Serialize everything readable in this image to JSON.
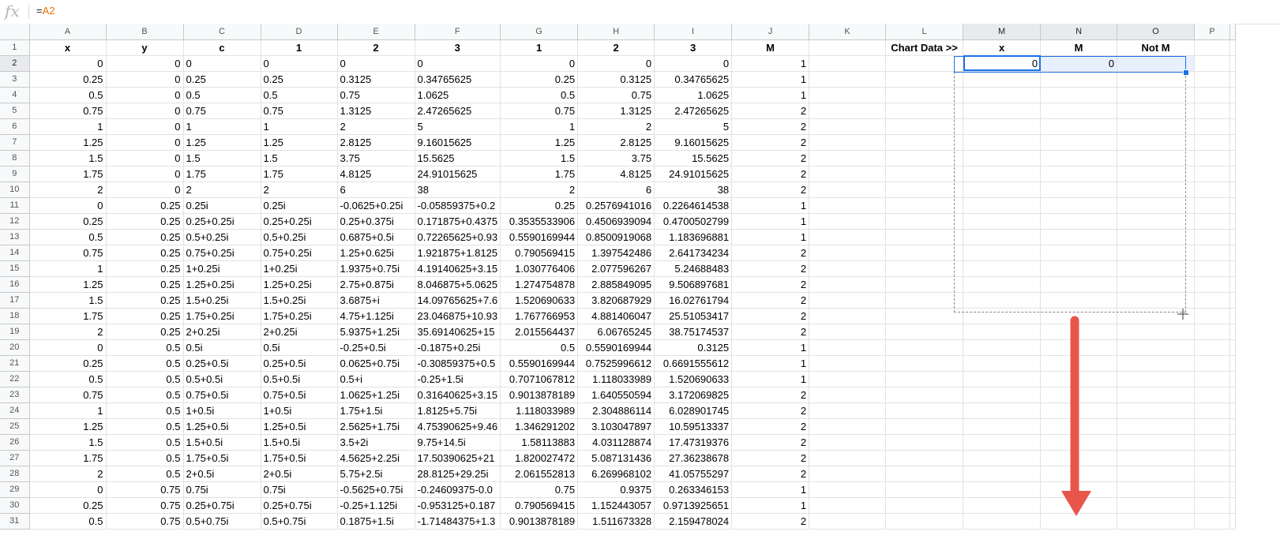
{
  "formula_bar": {
    "icon": "fx-icon",
    "prefix": "=",
    "ref": "A2"
  },
  "columns": [
    "A",
    "B",
    "C",
    "D",
    "E",
    "F",
    "G",
    "H",
    "I",
    "J",
    "K",
    "L",
    "M",
    "N",
    "O",
    "P"
  ],
  "selected_columns": [
    "M",
    "N",
    "O"
  ],
  "rows": [
    [
      {
        "v": "x",
        "c": "hdr"
      },
      {
        "v": "y",
        "c": "hdr"
      },
      {
        "v": "c",
        "c": "hdr"
      },
      {
        "v": "1",
        "c": "hdr"
      },
      {
        "v": "2",
        "c": "hdr"
      },
      {
        "v": "3",
        "c": "hdr"
      },
      {
        "v": "1",
        "c": "hdr"
      },
      {
        "v": "2",
        "c": "hdr"
      },
      {
        "v": "3",
        "c": "hdr"
      },
      {
        "v": "M",
        "c": "hdr"
      },
      {
        "v": "",
        "c": "txt"
      },
      {
        "v": "Chart Data >>",
        "c": "hdr"
      },
      {
        "v": "x",
        "c": "hdr"
      },
      {
        "v": "M",
        "c": "hdr"
      },
      {
        "v": "Not M",
        "c": "hdr"
      },
      {
        "v": "",
        "c": "txt"
      }
    ],
    [
      {
        "v": "0",
        "c": "num"
      },
      {
        "v": "0",
        "c": "num"
      },
      {
        "v": "0",
        "c": "txt"
      },
      {
        "v": "0",
        "c": "txt"
      },
      {
        "v": "0",
        "c": "txt"
      },
      {
        "v": "0",
        "c": "txt"
      },
      {
        "v": "0",
        "c": "num"
      },
      {
        "v": "0",
        "c": "num"
      },
      {
        "v": "0",
        "c": "num"
      },
      {
        "v": "1",
        "c": "num"
      },
      {
        "v": "",
        "c": "txt"
      },
      {
        "v": "",
        "c": "txt"
      },
      {
        "v": "0",
        "c": "num active"
      },
      {
        "v": "0",
        "c": "num selcell"
      },
      {
        "v": "",
        "c": "txt selcell"
      },
      {
        "v": "",
        "c": "txt"
      }
    ],
    [
      {
        "v": "0.25",
        "c": "num"
      },
      {
        "v": "0",
        "c": "num"
      },
      {
        "v": "0.25",
        "c": "txt"
      },
      {
        "v": "0.25",
        "c": "txt"
      },
      {
        "v": "0.3125",
        "c": "txt"
      },
      {
        "v": "0.34765625",
        "c": "txt"
      },
      {
        "v": "0.25",
        "c": "num"
      },
      {
        "v": "0.3125",
        "c": "num"
      },
      {
        "v": "0.34765625",
        "c": "num"
      },
      {
        "v": "1",
        "c": "num"
      }
    ],
    [
      {
        "v": "0.5",
        "c": "num"
      },
      {
        "v": "0",
        "c": "num"
      },
      {
        "v": "0.5",
        "c": "txt"
      },
      {
        "v": "0.5",
        "c": "txt"
      },
      {
        "v": "0.75",
        "c": "txt"
      },
      {
        "v": "1.0625",
        "c": "txt"
      },
      {
        "v": "0.5",
        "c": "num"
      },
      {
        "v": "0.75",
        "c": "num"
      },
      {
        "v": "1.0625",
        "c": "num"
      },
      {
        "v": "1",
        "c": "num"
      }
    ],
    [
      {
        "v": "0.75",
        "c": "num"
      },
      {
        "v": "0",
        "c": "num"
      },
      {
        "v": "0.75",
        "c": "txt"
      },
      {
        "v": "0.75",
        "c": "txt"
      },
      {
        "v": "1.3125",
        "c": "txt"
      },
      {
        "v": "2.47265625",
        "c": "txt"
      },
      {
        "v": "0.75",
        "c": "num"
      },
      {
        "v": "1.3125",
        "c": "num"
      },
      {
        "v": "2.47265625",
        "c": "num"
      },
      {
        "v": "2",
        "c": "num"
      }
    ],
    [
      {
        "v": "1",
        "c": "num"
      },
      {
        "v": "0",
        "c": "num"
      },
      {
        "v": "1",
        "c": "txt"
      },
      {
        "v": "1",
        "c": "txt"
      },
      {
        "v": "2",
        "c": "txt"
      },
      {
        "v": "5",
        "c": "txt"
      },
      {
        "v": "1",
        "c": "num"
      },
      {
        "v": "2",
        "c": "num"
      },
      {
        "v": "5",
        "c": "num"
      },
      {
        "v": "2",
        "c": "num"
      }
    ],
    [
      {
        "v": "1.25",
        "c": "num"
      },
      {
        "v": "0",
        "c": "num"
      },
      {
        "v": "1.25",
        "c": "txt"
      },
      {
        "v": "1.25",
        "c": "txt"
      },
      {
        "v": "2.8125",
        "c": "txt"
      },
      {
        "v": "9.16015625",
        "c": "txt"
      },
      {
        "v": "1.25",
        "c": "num"
      },
      {
        "v": "2.8125",
        "c": "num"
      },
      {
        "v": "9.16015625",
        "c": "num"
      },
      {
        "v": "2",
        "c": "num"
      }
    ],
    [
      {
        "v": "1.5",
        "c": "num"
      },
      {
        "v": "0",
        "c": "num"
      },
      {
        "v": "1.5",
        "c": "txt"
      },
      {
        "v": "1.5",
        "c": "txt"
      },
      {
        "v": "3.75",
        "c": "txt"
      },
      {
        "v": "15.5625",
        "c": "txt"
      },
      {
        "v": "1.5",
        "c": "num"
      },
      {
        "v": "3.75",
        "c": "num"
      },
      {
        "v": "15.5625",
        "c": "num"
      },
      {
        "v": "2",
        "c": "num"
      }
    ],
    [
      {
        "v": "1.75",
        "c": "num"
      },
      {
        "v": "0",
        "c": "num"
      },
      {
        "v": "1.75",
        "c": "txt"
      },
      {
        "v": "1.75",
        "c": "txt"
      },
      {
        "v": "4.8125",
        "c": "txt"
      },
      {
        "v": "24.91015625",
        "c": "txt"
      },
      {
        "v": "1.75",
        "c": "num"
      },
      {
        "v": "4.8125",
        "c": "num"
      },
      {
        "v": "24.91015625",
        "c": "num"
      },
      {
        "v": "2",
        "c": "num"
      }
    ],
    [
      {
        "v": "2",
        "c": "num"
      },
      {
        "v": "0",
        "c": "num"
      },
      {
        "v": "2",
        "c": "txt"
      },
      {
        "v": "2",
        "c": "txt"
      },
      {
        "v": "6",
        "c": "txt"
      },
      {
        "v": "38",
        "c": "txt"
      },
      {
        "v": "2",
        "c": "num"
      },
      {
        "v": "6",
        "c": "num"
      },
      {
        "v": "38",
        "c": "num"
      },
      {
        "v": "2",
        "c": "num"
      }
    ],
    [
      {
        "v": "0",
        "c": "num"
      },
      {
        "v": "0.25",
        "c": "num"
      },
      {
        "v": "0.25i",
        "c": "txt"
      },
      {
        "v": "0.25i",
        "c": "txt"
      },
      {
        "v": "-0.0625+0.25i",
        "c": "txt"
      },
      {
        "v": "-0.05859375+0.2",
        "c": "txt"
      },
      {
        "v": "0.25",
        "c": "num"
      },
      {
        "v": "0.2576941016",
        "c": "num"
      },
      {
        "v": "0.2264614538",
        "c": "num"
      },
      {
        "v": "1",
        "c": "num"
      }
    ],
    [
      {
        "v": "0.25",
        "c": "num"
      },
      {
        "v": "0.25",
        "c": "num"
      },
      {
        "v": "0.25+0.25i",
        "c": "txt"
      },
      {
        "v": "0.25+0.25i",
        "c": "txt"
      },
      {
        "v": "0.25+0.375i",
        "c": "txt"
      },
      {
        "v": "0.171875+0.4375",
        "c": "txt"
      },
      {
        "v": "0.3535533906",
        "c": "num"
      },
      {
        "v": "0.4506939094",
        "c": "num"
      },
      {
        "v": "0.4700502799",
        "c": "num"
      },
      {
        "v": "1",
        "c": "num"
      }
    ],
    [
      {
        "v": "0.5",
        "c": "num"
      },
      {
        "v": "0.25",
        "c": "num"
      },
      {
        "v": "0.5+0.25i",
        "c": "txt"
      },
      {
        "v": "0.5+0.25i",
        "c": "txt"
      },
      {
        "v": "0.6875+0.5i",
        "c": "txt"
      },
      {
        "v": "0.72265625+0.93",
        "c": "txt"
      },
      {
        "v": "0.5590169944",
        "c": "num"
      },
      {
        "v": "0.8500919068",
        "c": "num"
      },
      {
        "v": "1.183696881",
        "c": "num"
      },
      {
        "v": "1",
        "c": "num"
      }
    ],
    [
      {
        "v": "0.75",
        "c": "num"
      },
      {
        "v": "0.25",
        "c": "num"
      },
      {
        "v": "0.75+0.25i",
        "c": "txt"
      },
      {
        "v": "0.75+0.25i",
        "c": "txt"
      },
      {
        "v": "1.25+0.625i",
        "c": "txt"
      },
      {
        "v": "1.921875+1.8125",
        "c": "txt"
      },
      {
        "v": "0.790569415",
        "c": "num"
      },
      {
        "v": "1.397542486",
        "c": "num"
      },
      {
        "v": "2.641734234",
        "c": "num"
      },
      {
        "v": "2",
        "c": "num"
      }
    ],
    [
      {
        "v": "1",
        "c": "num"
      },
      {
        "v": "0.25",
        "c": "num"
      },
      {
        "v": "1+0.25i",
        "c": "txt"
      },
      {
        "v": "1+0.25i",
        "c": "txt"
      },
      {
        "v": "1.9375+0.75i",
        "c": "txt"
      },
      {
        "v": "4.19140625+3.15",
        "c": "txt"
      },
      {
        "v": "1.030776406",
        "c": "num"
      },
      {
        "v": "2.077596267",
        "c": "num"
      },
      {
        "v": "5.24688483",
        "c": "num"
      },
      {
        "v": "2",
        "c": "num"
      }
    ],
    [
      {
        "v": "1.25",
        "c": "num"
      },
      {
        "v": "0.25",
        "c": "num"
      },
      {
        "v": "1.25+0.25i",
        "c": "txt"
      },
      {
        "v": "1.25+0.25i",
        "c": "txt"
      },
      {
        "v": "2.75+0.875i",
        "c": "txt"
      },
      {
        "v": "8.046875+5.0625",
        "c": "txt"
      },
      {
        "v": "1.274754878",
        "c": "num"
      },
      {
        "v": "2.885849095",
        "c": "num"
      },
      {
        "v": "9.506897681",
        "c": "num"
      },
      {
        "v": "2",
        "c": "num"
      }
    ],
    [
      {
        "v": "1.5",
        "c": "num"
      },
      {
        "v": "0.25",
        "c": "num"
      },
      {
        "v": "1.5+0.25i",
        "c": "txt"
      },
      {
        "v": "1.5+0.25i",
        "c": "txt"
      },
      {
        "v": "3.6875+i",
        "c": "txt"
      },
      {
        "v": "14.09765625+7.6",
        "c": "txt"
      },
      {
        "v": "1.520690633",
        "c": "num"
      },
      {
        "v": "3.820687929",
        "c": "num"
      },
      {
        "v": "16.02761794",
        "c": "num"
      },
      {
        "v": "2",
        "c": "num"
      }
    ],
    [
      {
        "v": "1.75",
        "c": "num"
      },
      {
        "v": "0.25",
        "c": "num"
      },
      {
        "v": "1.75+0.25i",
        "c": "txt"
      },
      {
        "v": "1.75+0.25i",
        "c": "txt"
      },
      {
        "v": "4.75+1.125i",
        "c": "txt"
      },
      {
        "v": "23.046875+10.93",
        "c": "txt"
      },
      {
        "v": "1.767766953",
        "c": "num"
      },
      {
        "v": "4.881406047",
        "c": "num"
      },
      {
        "v": "25.51053417",
        "c": "num"
      },
      {
        "v": "2",
        "c": "num"
      }
    ],
    [
      {
        "v": "2",
        "c": "num"
      },
      {
        "v": "0.25",
        "c": "num"
      },
      {
        "v": "2+0.25i",
        "c": "txt"
      },
      {
        "v": "2+0.25i",
        "c": "txt"
      },
      {
        "v": "5.9375+1.25i",
        "c": "txt"
      },
      {
        "v": "35.69140625+15",
        "c": "txt"
      },
      {
        "v": "2.015564437",
        "c": "num"
      },
      {
        "v": "6.06765245",
        "c": "num"
      },
      {
        "v": "38.75174537",
        "c": "num"
      },
      {
        "v": "2",
        "c": "num"
      }
    ],
    [
      {
        "v": "0",
        "c": "num"
      },
      {
        "v": "0.5",
        "c": "num"
      },
      {
        "v": "0.5i",
        "c": "txt"
      },
      {
        "v": "0.5i",
        "c": "txt"
      },
      {
        "v": "-0.25+0.5i",
        "c": "txt"
      },
      {
        "v": "-0.1875+0.25i",
        "c": "txt"
      },
      {
        "v": "0.5",
        "c": "num"
      },
      {
        "v": "0.5590169944",
        "c": "num"
      },
      {
        "v": "0.3125",
        "c": "num"
      },
      {
        "v": "1",
        "c": "num"
      }
    ],
    [
      {
        "v": "0.25",
        "c": "num"
      },
      {
        "v": "0.5",
        "c": "num"
      },
      {
        "v": "0.25+0.5i",
        "c": "txt"
      },
      {
        "v": "0.25+0.5i",
        "c": "txt"
      },
      {
        "v": "0.0625+0.75i",
        "c": "txt"
      },
      {
        "v": "-0.30859375+0.5",
        "c": "txt"
      },
      {
        "v": "0.5590169944",
        "c": "num"
      },
      {
        "v": "0.7525996612",
        "c": "num"
      },
      {
        "v": "0.6691555612",
        "c": "num"
      },
      {
        "v": "1",
        "c": "num"
      }
    ],
    [
      {
        "v": "0.5",
        "c": "num"
      },
      {
        "v": "0.5",
        "c": "num"
      },
      {
        "v": "0.5+0.5i",
        "c": "txt"
      },
      {
        "v": "0.5+0.5i",
        "c": "txt"
      },
      {
        "v": "0.5+i",
        "c": "txt"
      },
      {
        "v": "-0.25+1.5i",
        "c": "txt"
      },
      {
        "v": "0.7071067812",
        "c": "num"
      },
      {
        "v": "1.118033989",
        "c": "num"
      },
      {
        "v": "1.520690633",
        "c": "num"
      },
      {
        "v": "1",
        "c": "num"
      }
    ],
    [
      {
        "v": "0.75",
        "c": "num"
      },
      {
        "v": "0.5",
        "c": "num"
      },
      {
        "v": "0.75+0.5i",
        "c": "txt"
      },
      {
        "v": "0.75+0.5i",
        "c": "txt"
      },
      {
        "v": "1.0625+1.25i",
        "c": "txt"
      },
      {
        "v": "0.31640625+3.15",
        "c": "txt"
      },
      {
        "v": "0.9013878189",
        "c": "num"
      },
      {
        "v": "1.640550594",
        "c": "num"
      },
      {
        "v": "3.172069825",
        "c": "num"
      },
      {
        "v": "2",
        "c": "num"
      }
    ],
    [
      {
        "v": "1",
        "c": "num"
      },
      {
        "v": "0.5",
        "c": "num"
      },
      {
        "v": "1+0.5i",
        "c": "txt"
      },
      {
        "v": "1+0.5i",
        "c": "txt"
      },
      {
        "v": "1.75+1.5i",
        "c": "txt"
      },
      {
        "v": "1.8125+5.75i",
        "c": "txt"
      },
      {
        "v": "1.118033989",
        "c": "num"
      },
      {
        "v": "2.304886114",
        "c": "num"
      },
      {
        "v": "6.028901745",
        "c": "num"
      },
      {
        "v": "2",
        "c": "num"
      }
    ],
    [
      {
        "v": "1.25",
        "c": "num"
      },
      {
        "v": "0.5",
        "c": "num"
      },
      {
        "v": "1.25+0.5i",
        "c": "txt"
      },
      {
        "v": "1.25+0.5i",
        "c": "txt"
      },
      {
        "v": "2.5625+1.75i",
        "c": "txt"
      },
      {
        "v": "4.75390625+9.46",
        "c": "txt"
      },
      {
        "v": "1.346291202",
        "c": "num"
      },
      {
        "v": "3.103047897",
        "c": "num"
      },
      {
        "v": "10.59513337",
        "c": "num"
      },
      {
        "v": "2",
        "c": "num"
      }
    ],
    [
      {
        "v": "1.5",
        "c": "num"
      },
      {
        "v": "0.5",
        "c": "num"
      },
      {
        "v": "1.5+0.5i",
        "c": "txt"
      },
      {
        "v": "1.5+0.5i",
        "c": "txt"
      },
      {
        "v": "3.5+2i",
        "c": "txt"
      },
      {
        "v": "9.75+14.5i",
        "c": "txt"
      },
      {
        "v": "1.58113883",
        "c": "num"
      },
      {
        "v": "4.031128874",
        "c": "num"
      },
      {
        "v": "17.47319376",
        "c": "num"
      },
      {
        "v": "2",
        "c": "num"
      }
    ],
    [
      {
        "v": "1.75",
        "c": "num"
      },
      {
        "v": "0.5",
        "c": "num"
      },
      {
        "v": "1.75+0.5i",
        "c": "txt"
      },
      {
        "v": "1.75+0.5i",
        "c": "txt"
      },
      {
        "v": "4.5625+2.25i",
        "c": "txt"
      },
      {
        "v": "17.50390625+21",
        "c": "txt"
      },
      {
        "v": "1.820027472",
        "c": "num"
      },
      {
        "v": "5.087131436",
        "c": "num"
      },
      {
        "v": "27.36238678",
        "c": "num"
      },
      {
        "v": "2",
        "c": "num"
      }
    ],
    [
      {
        "v": "2",
        "c": "num"
      },
      {
        "v": "0.5",
        "c": "num"
      },
      {
        "v": "2+0.5i",
        "c": "txt"
      },
      {
        "v": "2+0.5i",
        "c": "txt"
      },
      {
        "v": "5.75+2.5i",
        "c": "txt"
      },
      {
        "v": "28.8125+29.25i",
        "c": "txt"
      },
      {
        "v": "2.061552813",
        "c": "num"
      },
      {
        "v": "6.269968102",
        "c": "num"
      },
      {
        "v": "41.05755297",
        "c": "num"
      },
      {
        "v": "2",
        "c": "num"
      }
    ],
    [
      {
        "v": "0",
        "c": "num"
      },
      {
        "v": "0.75",
        "c": "num"
      },
      {
        "v": "0.75i",
        "c": "txt"
      },
      {
        "v": "0.75i",
        "c": "txt"
      },
      {
        "v": "-0.5625+0.75i",
        "c": "txt"
      },
      {
        "v": "-0.24609375-0.0",
        "c": "txt"
      },
      {
        "v": "0.75",
        "c": "num"
      },
      {
        "v": "0.9375",
        "c": "num"
      },
      {
        "v": "0.263346153",
        "c": "num"
      },
      {
        "v": "1",
        "c": "num"
      }
    ],
    [
      {
        "v": "0.25",
        "c": "num"
      },
      {
        "v": "0.75",
        "c": "num"
      },
      {
        "v": "0.25+0.75i",
        "c": "txt"
      },
      {
        "v": "0.25+0.75i",
        "c": "txt"
      },
      {
        "v": "-0.25+1.125i",
        "c": "txt"
      },
      {
        "v": "-0.953125+0.187",
        "c": "txt"
      },
      {
        "v": "0.790569415",
        "c": "num"
      },
      {
        "v": "1.152443057",
        "c": "num"
      },
      {
        "v": "0.9713925651",
        "c": "num"
      },
      {
        "v": "1",
        "c": "num"
      }
    ],
    [
      {
        "v": "0.5",
        "c": "num"
      },
      {
        "v": "0.75",
        "c": "num"
      },
      {
        "v": "0.5+0.75i",
        "c": "txt"
      },
      {
        "v": "0.5+0.75i",
        "c": "txt"
      },
      {
        "v": "0.1875+1.5i",
        "c": "txt"
      },
      {
        "v": "-1.71484375+1.3",
        "c": "txt"
      },
      {
        "v": "0.9013878189",
        "c": "num"
      },
      {
        "v": "1.511673328",
        "c": "num"
      },
      {
        "v": "2.159478024",
        "c": "num"
      },
      {
        "v": "2",
        "c": "num"
      }
    ]
  ],
  "accent_color": "#1a73e8",
  "arrow_color": "#e8554a"
}
